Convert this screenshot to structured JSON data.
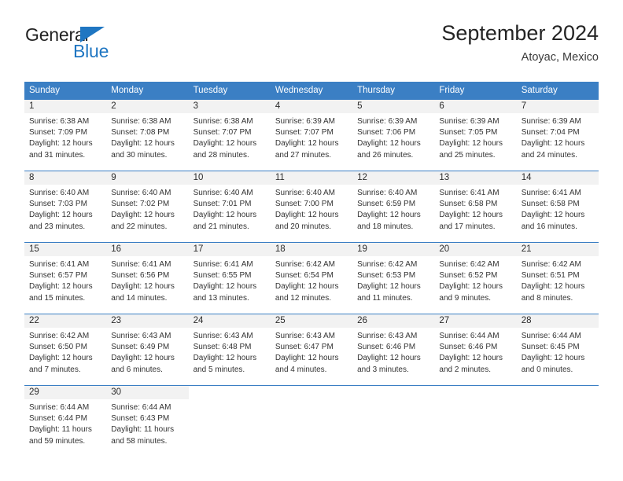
{
  "brand": {
    "word1": "General",
    "word2": "Blue",
    "flag_icon": "triangle-flag-icon",
    "accent_color": "#1f76c2"
  },
  "header": {
    "month_title": "September 2024",
    "location": "Atoyac, Mexico"
  },
  "colors": {
    "header_blue": "#3b7fc4",
    "daynum_strip": "#f2f2f2",
    "text": "#333333"
  },
  "weekdays": [
    "Sunday",
    "Monday",
    "Tuesday",
    "Wednesday",
    "Thursday",
    "Friday",
    "Saturday"
  ],
  "labels": {
    "sunrise_prefix": "Sunrise:",
    "sunset_prefix": "Sunset:",
    "daylight_prefix": "Daylight:"
  },
  "weeks": [
    {
      "days": [
        {
          "num": "1",
          "sunrise": "Sunrise: 6:38 AM",
          "sunset": "Sunset: 7:09 PM",
          "daylight1": "Daylight: 12 hours",
          "daylight2": "and 31 minutes."
        },
        {
          "num": "2",
          "sunrise": "Sunrise: 6:38 AM",
          "sunset": "Sunset: 7:08 PM",
          "daylight1": "Daylight: 12 hours",
          "daylight2": "and 30 minutes."
        },
        {
          "num": "3",
          "sunrise": "Sunrise: 6:38 AM",
          "sunset": "Sunset: 7:07 PM",
          "daylight1": "Daylight: 12 hours",
          "daylight2": "and 28 minutes."
        },
        {
          "num": "4",
          "sunrise": "Sunrise: 6:39 AM",
          "sunset": "Sunset: 7:07 PM",
          "daylight1": "Daylight: 12 hours",
          "daylight2": "and 27 minutes."
        },
        {
          "num": "5",
          "sunrise": "Sunrise: 6:39 AM",
          "sunset": "Sunset: 7:06 PM",
          "daylight1": "Daylight: 12 hours",
          "daylight2": "and 26 minutes."
        },
        {
          "num": "6",
          "sunrise": "Sunrise: 6:39 AM",
          "sunset": "Sunset: 7:05 PM",
          "daylight1": "Daylight: 12 hours",
          "daylight2": "and 25 minutes."
        },
        {
          "num": "7",
          "sunrise": "Sunrise: 6:39 AM",
          "sunset": "Sunset: 7:04 PM",
          "daylight1": "Daylight: 12 hours",
          "daylight2": "and 24 minutes."
        }
      ]
    },
    {
      "days": [
        {
          "num": "8",
          "sunrise": "Sunrise: 6:40 AM",
          "sunset": "Sunset: 7:03 PM",
          "daylight1": "Daylight: 12 hours",
          "daylight2": "and 23 minutes."
        },
        {
          "num": "9",
          "sunrise": "Sunrise: 6:40 AM",
          "sunset": "Sunset: 7:02 PM",
          "daylight1": "Daylight: 12 hours",
          "daylight2": "and 22 minutes."
        },
        {
          "num": "10",
          "sunrise": "Sunrise: 6:40 AM",
          "sunset": "Sunset: 7:01 PM",
          "daylight1": "Daylight: 12 hours",
          "daylight2": "and 21 minutes."
        },
        {
          "num": "11",
          "sunrise": "Sunrise: 6:40 AM",
          "sunset": "Sunset: 7:00 PM",
          "daylight1": "Daylight: 12 hours",
          "daylight2": "and 20 minutes."
        },
        {
          "num": "12",
          "sunrise": "Sunrise: 6:40 AM",
          "sunset": "Sunset: 6:59 PM",
          "daylight1": "Daylight: 12 hours",
          "daylight2": "and 18 minutes."
        },
        {
          "num": "13",
          "sunrise": "Sunrise: 6:41 AM",
          "sunset": "Sunset: 6:58 PM",
          "daylight1": "Daylight: 12 hours",
          "daylight2": "and 17 minutes."
        },
        {
          "num": "14",
          "sunrise": "Sunrise: 6:41 AM",
          "sunset": "Sunset: 6:58 PM",
          "daylight1": "Daylight: 12 hours",
          "daylight2": "and 16 minutes."
        }
      ]
    },
    {
      "days": [
        {
          "num": "15",
          "sunrise": "Sunrise: 6:41 AM",
          "sunset": "Sunset: 6:57 PM",
          "daylight1": "Daylight: 12 hours",
          "daylight2": "and 15 minutes."
        },
        {
          "num": "16",
          "sunrise": "Sunrise: 6:41 AM",
          "sunset": "Sunset: 6:56 PM",
          "daylight1": "Daylight: 12 hours",
          "daylight2": "and 14 minutes."
        },
        {
          "num": "17",
          "sunrise": "Sunrise: 6:41 AM",
          "sunset": "Sunset: 6:55 PM",
          "daylight1": "Daylight: 12 hours",
          "daylight2": "and 13 minutes."
        },
        {
          "num": "18",
          "sunrise": "Sunrise: 6:42 AM",
          "sunset": "Sunset: 6:54 PM",
          "daylight1": "Daylight: 12 hours",
          "daylight2": "and 12 minutes."
        },
        {
          "num": "19",
          "sunrise": "Sunrise: 6:42 AM",
          "sunset": "Sunset: 6:53 PM",
          "daylight1": "Daylight: 12 hours",
          "daylight2": "and 11 minutes."
        },
        {
          "num": "20",
          "sunrise": "Sunrise: 6:42 AM",
          "sunset": "Sunset: 6:52 PM",
          "daylight1": "Daylight: 12 hours",
          "daylight2": "and 9 minutes."
        },
        {
          "num": "21",
          "sunrise": "Sunrise: 6:42 AM",
          "sunset": "Sunset: 6:51 PM",
          "daylight1": "Daylight: 12 hours",
          "daylight2": "and 8 minutes."
        }
      ]
    },
    {
      "days": [
        {
          "num": "22",
          "sunrise": "Sunrise: 6:42 AM",
          "sunset": "Sunset: 6:50 PM",
          "daylight1": "Daylight: 12 hours",
          "daylight2": "and 7 minutes."
        },
        {
          "num": "23",
          "sunrise": "Sunrise: 6:43 AM",
          "sunset": "Sunset: 6:49 PM",
          "daylight1": "Daylight: 12 hours",
          "daylight2": "and 6 minutes."
        },
        {
          "num": "24",
          "sunrise": "Sunrise: 6:43 AM",
          "sunset": "Sunset: 6:48 PM",
          "daylight1": "Daylight: 12 hours",
          "daylight2": "and 5 minutes."
        },
        {
          "num": "25",
          "sunrise": "Sunrise: 6:43 AM",
          "sunset": "Sunset: 6:47 PM",
          "daylight1": "Daylight: 12 hours",
          "daylight2": "and 4 minutes."
        },
        {
          "num": "26",
          "sunrise": "Sunrise: 6:43 AM",
          "sunset": "Sunset: 6:46 PM",
          "daylight1": "Daylight: 12 hours",
          "daylight2": "and 3 minutes."
        },
        {
          "num": "27",
          "sunrise": "Sunrise: 6:44 AM",
          "sunset": "Sunset: 6:46 PM",
          "daylight1": "Daylight: 12 hours",
          "daylight2": "and 2 minutes."
        },
        {
          "num": "28",
          "sunrise": "Sunrise: 6:44 AM",
          "sunset": "Sunset: 6:45 PM",
          "daylight1": "Daylight: 12 hours",
          "daylight2": "and 0 minutes."
        }
      ]
    },
    {
      "days": [
        {
          "num": "29",
          "sunrise": "Sunrise: 6:44 AM",
          "sunset": "Sunset: 6:44 PM",
          "daylight1": "Daylight: 11 hours",
          "daylight2": "and 59 minutes."
        },
        {
          "num": "30",
          "sunrise": "Sunrise: 6:44 AM",
          "sunset": "Sunset: 6:43 PM",
          "daylight1": "Daylight: 11 hours",
          "daylight2": "and 58 minutes."
        },
        {
          "num": "",
          "sunrise": "",
          "sunset": "",
          "daylight1": "",
          "daylight2": ""
        },
        {
          "num": "",
          "sunrise": "",
          "sunset": "",
          "daylight1": "",
          "daylight2": ""
        },
        {
          "num": "",
          "sunrise": "",
          "sunset": "",
          "daylight1": "",
          "daylight2": ""
        },
        {
          "num": "",
          "sunrise": "",
          "sunset": "",
          "daylight1": "",
          "daylight2": ""
        },
        {
          "num": "",
          "sunrise": "",
          "sunset": "",
          "daylight1": "",
          "daylight2": ""
        }
      ]
    }
  ]
}
